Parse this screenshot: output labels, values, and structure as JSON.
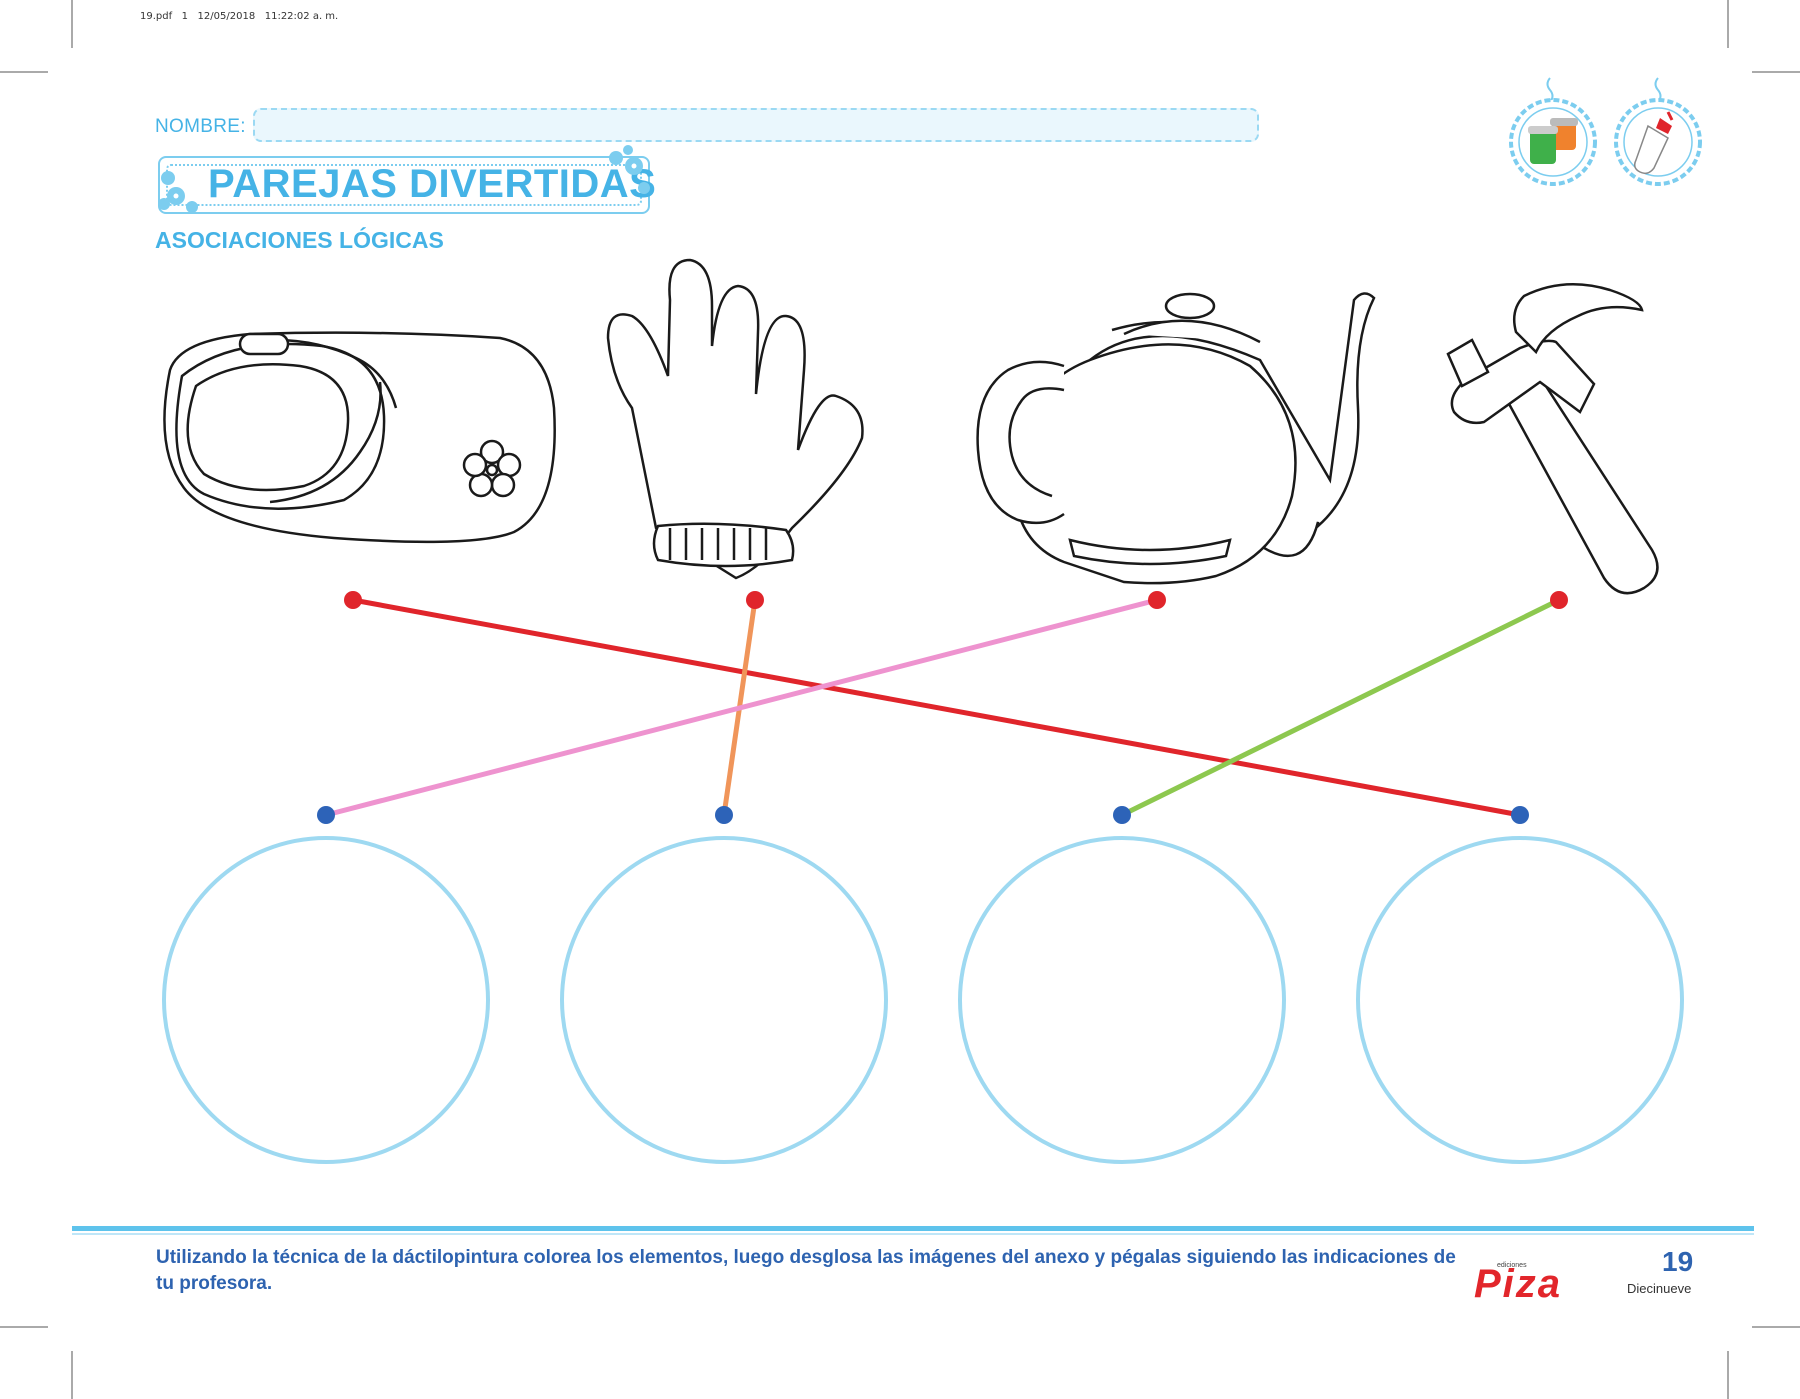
{
  "print_header": "19.pdf   1   12/05/2018   11:22:02 a. m.",
  "name_label": "NOMBRE:",
  "title": "PAREJAS DIVERTIDAS",
  "subtitle": "ASOCIACIONES LÓGICAS",
  "icons": [
    "finger-paint-jars-icon",
    "glue-bottle-icon"
  ],
  "objects": [
    "shoe",
    "glove",
    "teapot",
    "hammer"
  ],
  "connections": [
    {
      "from": 1,
      "to": 4,
      "color": "#e0252b"
    },
    {
      "from": 2,
      "to": 2,
      "color": "#f0955a"
    },
    {
      "from": 3,
      "to": 1,
      "color": "#ee93cf"
    },
    {
      "from": 4,
      "to": 3,
      "color": "#8dc84f"
    }
  ],
  "colors": {
    "accent": "#45b3e6",
    "circle": "#9ed9f1",
    "top_dot": "#e0252b",
    "bottom_dot": "#2d63b8",
    "instruction": "#2e63b0"
  },
  "footer": {
    "instruction": "Utilizando la técnica de la dáctilopintura colorea los elementos, luego desglosa las imágenes del anexo y pégalas siguiendo las indicaciones de tu profesora.",
    "publisher_small": "ediciones",
    "publisher": "Piza",
    "page_number": "19",
    "page_word": "Diecinueve"
  }
}
